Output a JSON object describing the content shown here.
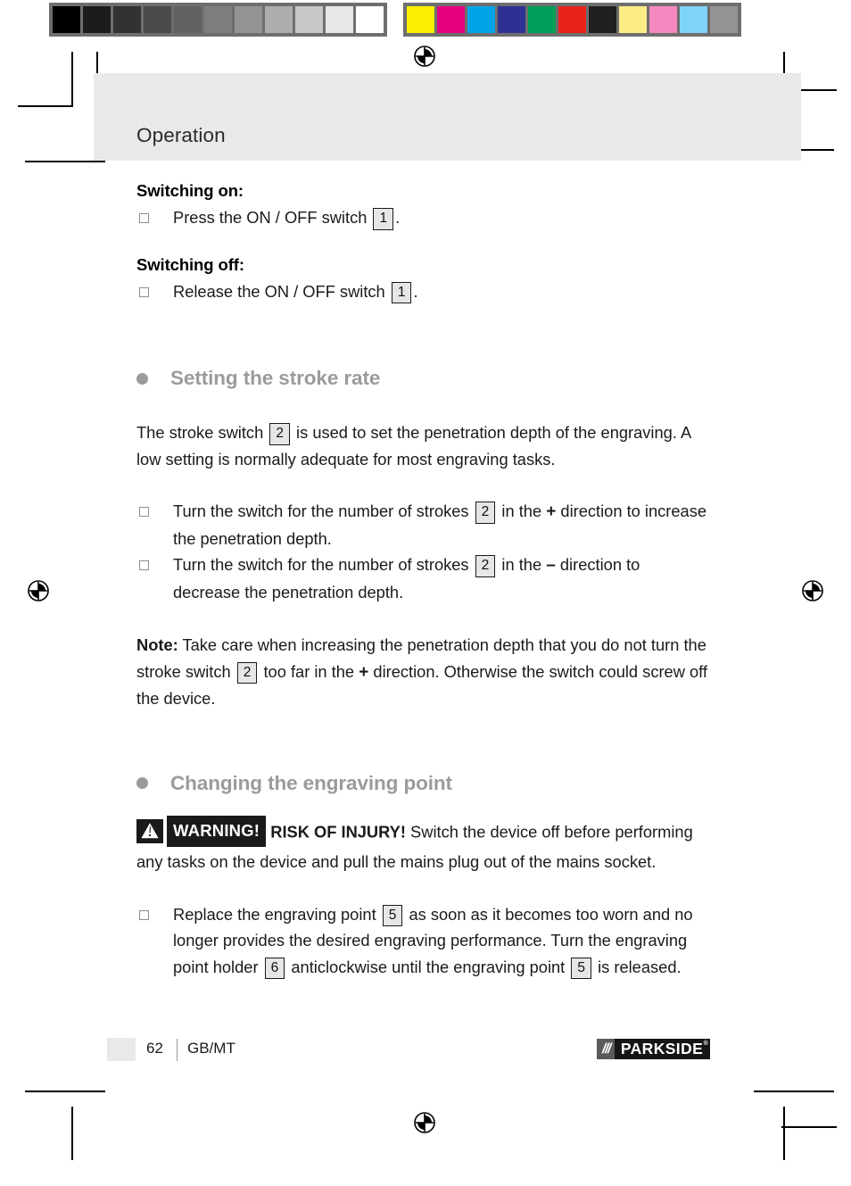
{
  "control_strip": {
    "gray_swatches": [
      "#000000",
      "#1c1c1c",
      "#323232",
      "#4b4b4b",
      "#616161",
      "#7d7d7d",
      "#949494",
      "#adadad",
      "#c7c7c7",
      "#e7e7e7",
      "#ffffff"
    ],
    "color_swatches": [
      "#fdee00",
      "#e6007e",
      "#00a3e8",
      "#2e3192",
      "#00a05a",
      "#e8231b",
      "#1f1f1f",
      "#fced85",
      "#f489c0",
      "#7ed4f7",
      "#949494"
    ],
    "strip_background": "#6e6e6e"
  },
  "header": {
    "title": "Operation",
    "band_color": "#e9e9e9"
  },
  "content": {
    "switching_on": {
      "heading": "Switching on:",
      "item_prefix": "Press the ON / OFF switch",
      "ref": "1",
      "item_suffix": "."
    },
    "switching_off": {
      "heading": "Switching off:",
      "item_prefix": "Release the ON / OFF switch",
      "ref": "1",
      "item_suffix": "."
    },
    "stroke_rate": {
      "heading": "Setting the stroke rate",
      "intro_a": "The stroke switch",
      "intro_ref": "2",
      "intro_b": "is used to set the penetration depth of the engraving. A low setting is normally adequate for most engraving tasks.",
      "bullets": [
        {
          "a": "Turn the switch for the number of strokes",
          "ref": "2",
          "b": "in the",
          "sign": "+",
          "c": "direction to increase the penetration depth."
        },
        {
          "a": "Turn the switch for the number of strokes",
          "ref": "2",
          "b": "in the",
          "sign": "–",
          "c": "direction to decrease the penetration depth."
        }
      ],
      "note_label": "Note:",
      "note_a": "Take care when increasing the penetration depth that you do not turn the stroke switch",
      "note_ref": "2",
      "note_b": "too far in the",
      "note_sign": "+",
      "note_c": "direction. Otherwise the switch could screw off the device."
    },
    "engraving_point": {
      "heading": "Changing the engraving point",
      "warning_label": "WARNING!",
      "warning_icon": "warning-triangle-icon",
      "risk_label": "RISK OF INJURY!",
      "warning_text": "Switch the device off before performing any tasks on the device and pull the mains plug out of the mains socket.",
      "bullet": {
        "a": "Replace the engraving point",
        "ref1": "5",
        "b": "as soon as it becomes too worn and no longer provides the desired engraving performance. Turn the engraving point holder",
        "ref2": "6",
        "c": "anticlockwise until the engraving point",
        "ref3": "5",
        "d": "is released."
      }
    },
    "heading_color": "#9b9b9b"
  },
  "footer": {
    "page_number": "62",
    "language": "GB/MT",
    "logo_slashes": "///",
    "logo_name": "PARKSIDE",
    "logo_registered": "®"
  }
}
